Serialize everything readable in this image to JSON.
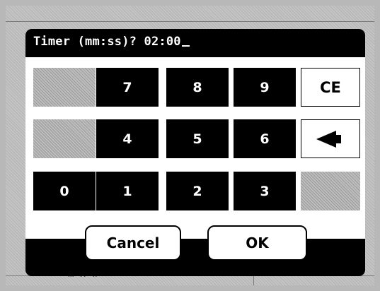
{
  "background": {
    "fragment_text": "m x w"
  },
  "dialog": {
    "prompt": "Timer (mm:ss)? 02:00"
  },
  "keypad": {
    "row1": [
      "7",
      "8",
      "9"
    ],
    "row2": [
      "4",
      "5",
      "6"
    ],
    "row3": [
      "0",
      "1",
      "2",
      "3"
    ],
    "clear_label": "CE",
    "backspace_icon": "left-arrow-icon"
  },
  "buttons": {
    "cancel_label": "Cancel",
    "ok_label": "OK"
  }
}
